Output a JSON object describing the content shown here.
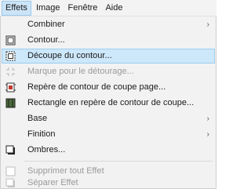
{
  "menubar": {
    "items": [
      "Effets",
      "Image",
      "Fenêtre",
      "Aide"
    ]
  },
  "menu": {
    "items": [
      {
        "label": "Combiner",
        "icon": "none",
        "submenu": true,
        "enabled": true
      },
      {
        "label": "Contour...",
        "icon": "contour-icon",
        "submenu": false,
        "enabled": true
      },
      {
        "label": "Découpe du contour...",
        "icon": "cut-contour-icon",
        "submenu": false,
        "enabled": true,
        "highlighted": true
      },
      {
        "label": "Marque pour le détourage...",
        "icon": "trim-mark-icon",
        "submenu": false,
        "enabled": false
      },
      {
        "label": "Repère de contour de coupe page...",
        "icon": "page-crop-mark-icon",
        "submenu": false,
        "enabled": true
      },
      {
        "label": "Rectangle en repère de contour de coupe...",
        "icon": "rectangle-crop-mark-icon",
        "submenu": false,
        "enabled": true
      },
      {
        "label": "Base",
        "icon": "none",
        "submenu": true,
        "enabled": true
      },
      {
        "label": "Finition",
        "icon": "none",
        "submenu": true,
        "enabled": true
      },
      {
        "label": "Ombres...",
        "icon": "shadow-icon",
        "submenu": false,
        "enabled": true
      },
      {
        "label": "Supprimer tout Effet",
        "icon": "remove-effect-icon",
        "submenu": false,
        "enabled": false
      },
      {
        "label": "Séparer Effet",
        "icon": "separate-effect-icon",
        "submenu": false,
        "enabled": false
      }
    ],
    "submenu_arrow": "›"
  },
  "colors": {
    "highlight": "#cde8fb",
    "active_menubar": "#cce4f7"
  }
}
